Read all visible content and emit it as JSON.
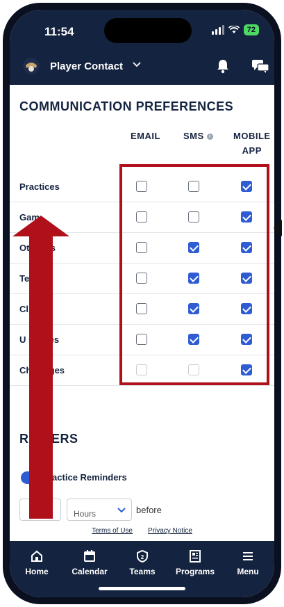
{
  "status_bar": {
    "time": "11:54",
    "battery": "72"
  },
  "header": {
    "title": "Player Contact"
  },
  "preferences": {
    "title": "COMMUNICATION PREFERENCES",
    "columns": {
      "email": "EMAIL",
      "sms": "SMS",
      "mobile_line1": "MOBILE",
      "mobile_line2": "APP"
    },
    "rows": [
      {
        "label": "Practices",
        "email": false,
        "sms": false,
        "mobile": true,
        "disabled": false
      },
      {
        "label": "Gam",
        "email": false,
        "sms": false,
        "mobile": true,
        "disabled": false
      },
      {
        "label": "Ot       vents",
        "email": false,
        "sms": true,
        "mobile": true,
        "disabled": false
      },
      {
        "label": "Te      lerts",
        "email": false,
        "sms": true,
        "mobile": true,
        "disabled": false
      },
      {
        "label": "Cl      erts",
        "email": false,
        "sms": true,
        "mobile": true,
        "disabled": false
      },
      {
        "label": "U       ssages",
        "email": false,
        "sms": true,
        "mobile": true,
        "disabled": false
      },
      {
        "label": "Ch      ssages",
        "email": false,
        "sms": false,
        "mobile": true,
        "disabled": true
      }
    ]
  },
  "reminders": {
    "title": "R       NDERS",
    "toggle_label": "ractice Reminders",
    "unit_value": "Hours",
    "after_text": "before"
  },
  "footer": {
    "terms": "Terms of Use",
    "privacy": "Privacy Notice"
  },
  "tabbar": {
    "home": "Home",
    "calendar": "Calendar",
    "teams": "Teams",
    "programs": "Programs",
    "menu": "Menu"
  },
  "colors": {
    "navy": "#14233f",
    "accent": "#2f5bd3",
    "annotation_red": "#b0101a"
  }
}
